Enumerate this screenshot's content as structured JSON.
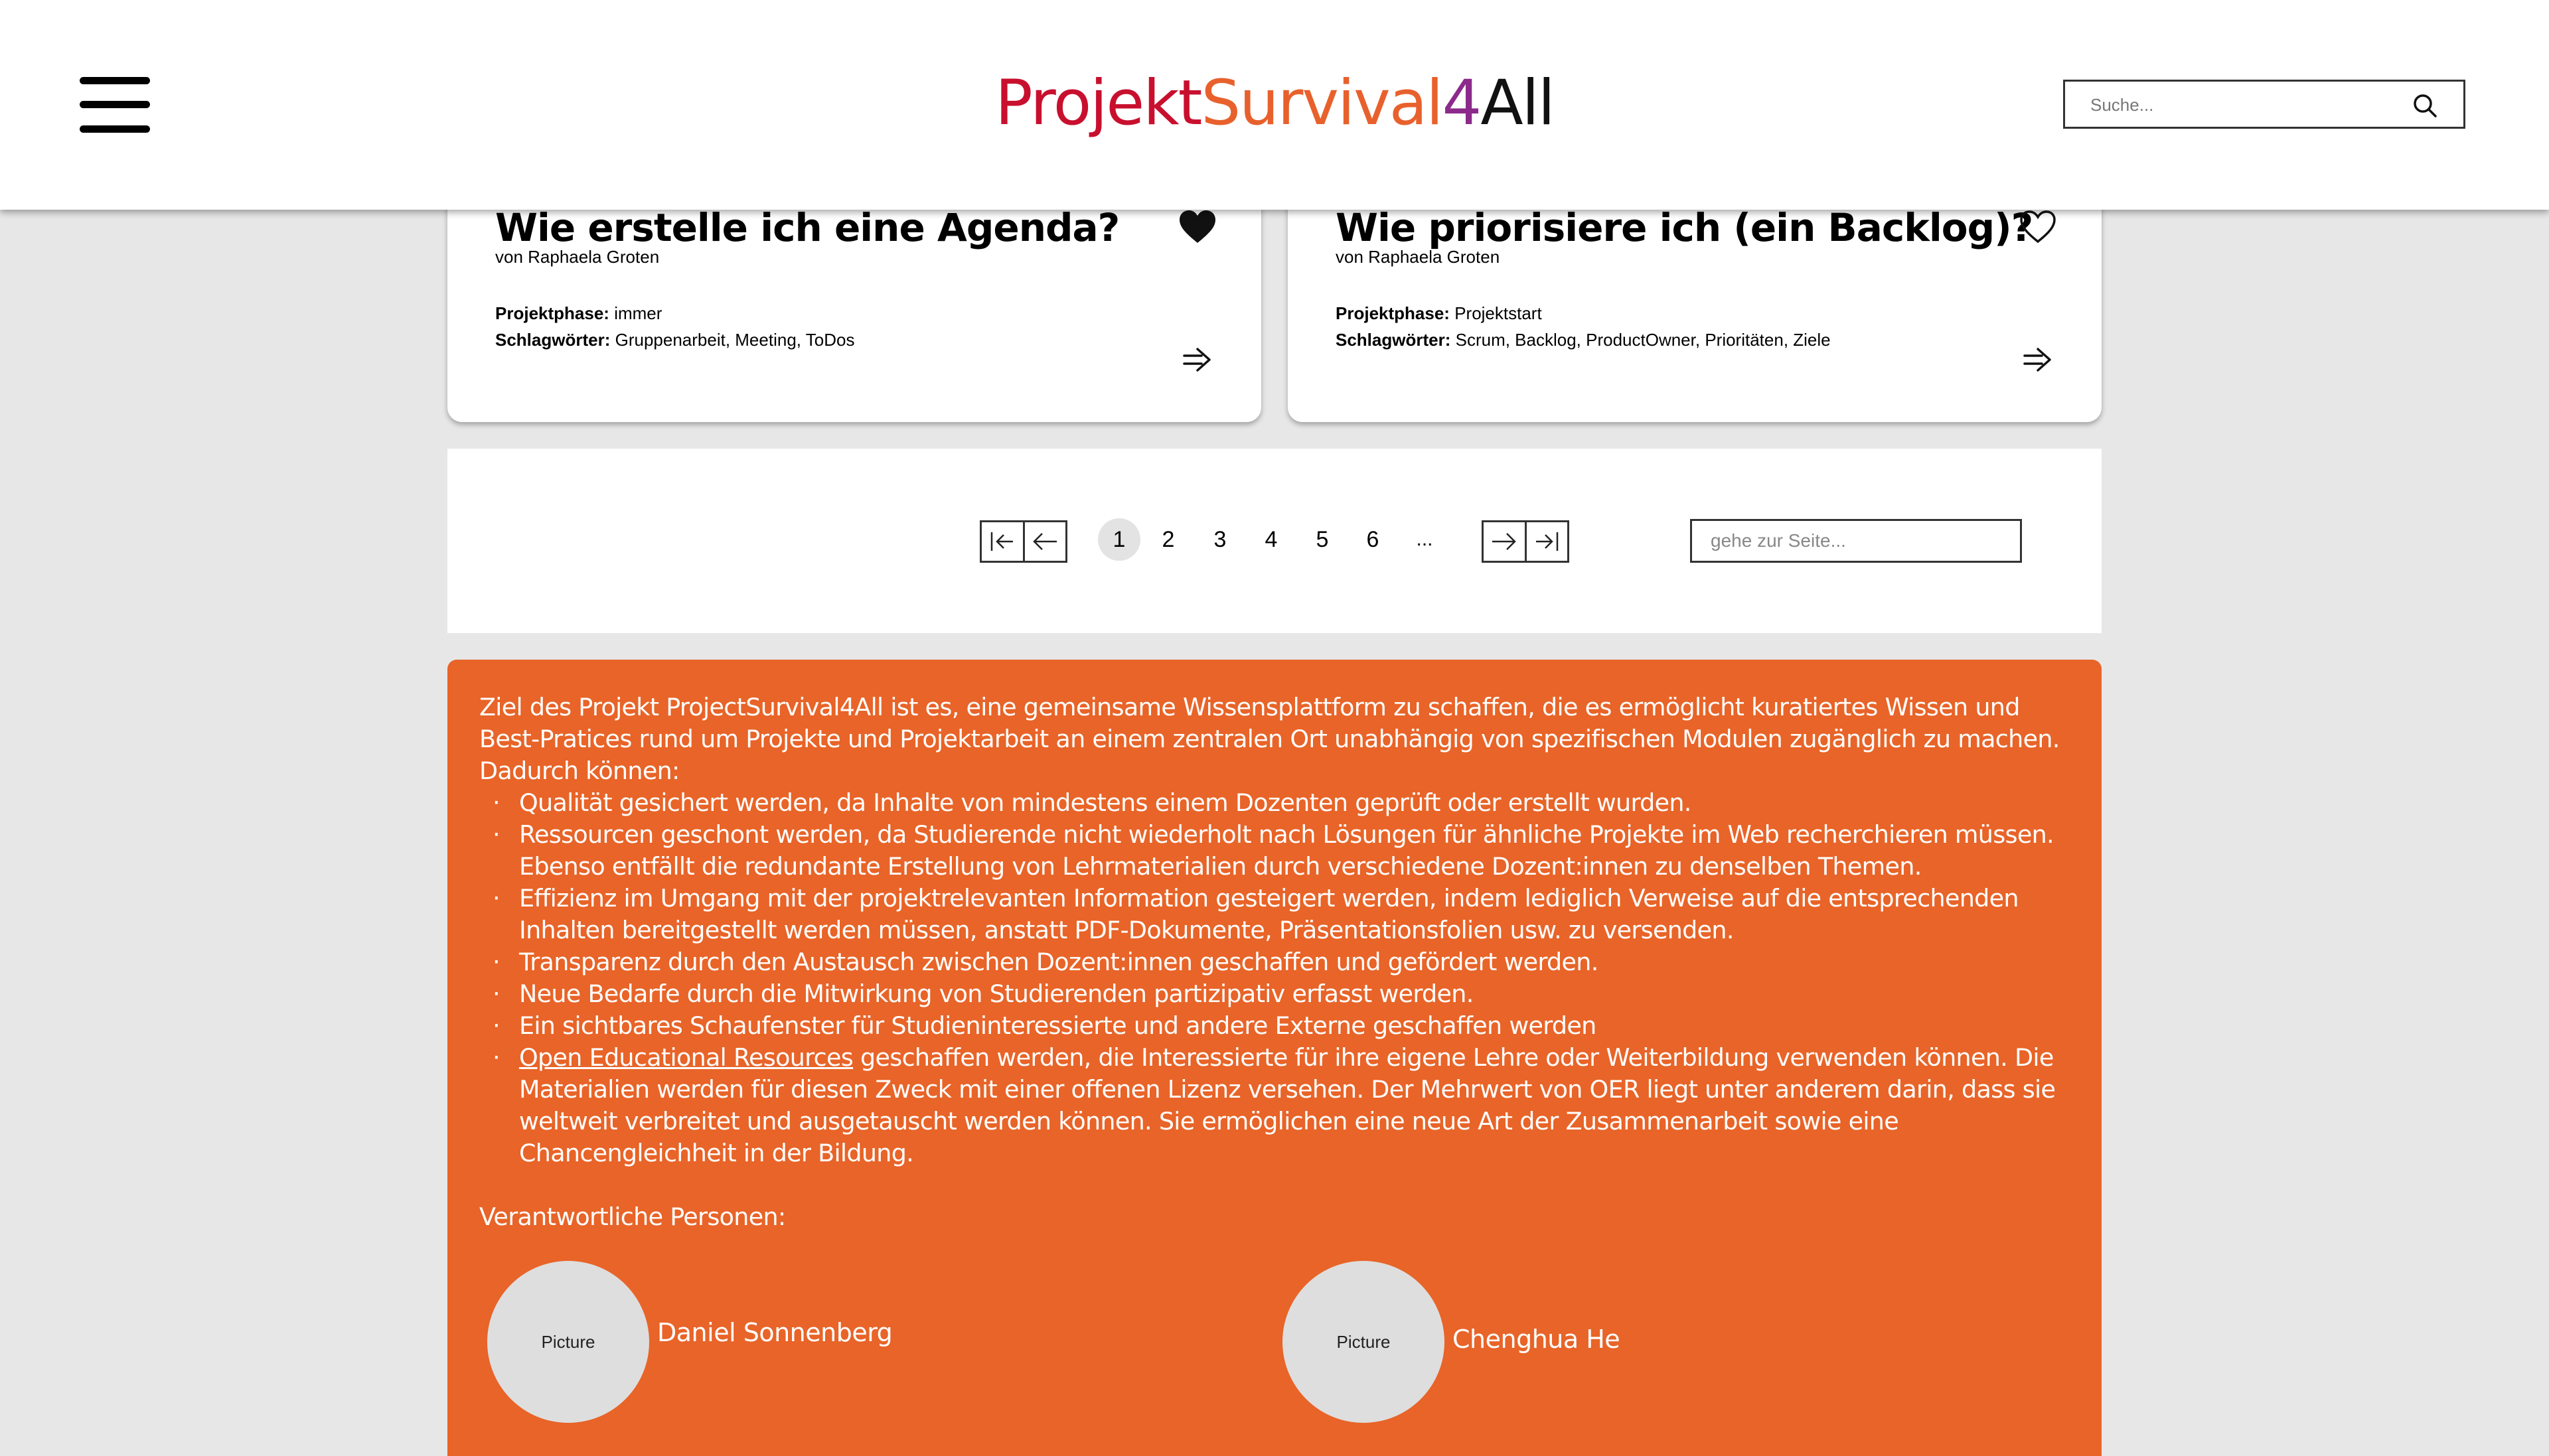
{
  "header": {
    "logo": {
      "part1": "Projekt",
      "part2": "Survival",
      "part3": "4",
      "part4": "All"
    },
    "search_placeholder": "Suche...",
    "colors": {
      "projekt": "#c8102e",
      "survival": "#e8612c",
      "four": "#8c2a8c",
      "all": "#111111"
    }
  },
  "cards": [
    {
      "title": "Wie erstelle ich eine Agenda?",
      "author": "von Raphaela Groten",
      "phase_label": "Projektphase:",
      "phase_value": "immer",
      "tags_label": "Schlagwörter:",
      "tags_value": "Gruppenarbeit, Meeting, ToDos",
      "favorite": true,
      "icon": "heart-filled-icon"
    },
    {
      "title": "Wie priorisiere ich (ein Backlog)?",
      "author": "von Raphaela Groten",
      "phase_label": "Projektphase:",
      "phase_value": "Projektstart",
      "tags_label": "Schlagwörter:",
      "tags_value": "Scrum, Backlog, ProductOwner, Prioritäten, Ziele",
      "favorite": false,
      "icon": "heart-outline-icon"
    }
  ],
  "pagination": {
    "pages": [
      "1",
      "2",
      "3",
      "4",
      "5",
      "6"
    ],
    "ellipsis": "...",
    "current": "1",
    "goto_placeholder": "gehe zur Seite..."
  },
  "about": {
    "intro": "Ziel des Projekt ProjectSurvival4All ist es, eine gemeinsame Wissensplattform zu schaffen, die es ermöglicht kuratiertes Wissen und Best-Pratices rund um Projekte und Projektarbeit an einem zentralen Ort unabhängig von spezifischen Modulen zugänglich zu machen. Dadurch können:",
    "bullets": [
      "Qualität gesichert werden, da Inhalte von mindestens einem Dozenten geprüft oder erstellt wurden.",
      "Ressourcen geschont werden, da Studierende nicht wiederholt nach Lösungen für ähnliche Projekte im Web recherchieren müssen. Ebenso entfällt die redundante Erstellung von Lehrmaterialien durch verschiedene Dozent:innen zu denselben Themen.",
      "Effizienz im Umgang mit der projektrelevanten Information gesteigert werden, indem lediglich Verweise auf die entsprechenden Inhalten bereitgestellt werden müssen, anstatt PDF-Dokumente, Präsentationsfolien usw. zu versenden.",
      "Transparenz durch den Austausch zwischen Dozent:innen geschaffen und gefördert werden.",
      "Neue Bedarfe durch die Mitwirkung von Studierenden partizipativ erfasst werden.",
      "Ein sichtbares Schaufenster für Studieninteressierte und andere Externe geschaffen werden"
    ],
    "oer_link": "Open Educational Resources",
    "oer_text": " geschaffen werden, die Interessierte für ihre eigene Lehre oder Weiterbildung verwenden können. Die Materialien werden für diesen Zweck mit einer offenen Lizenz versehen. Der Mehrwert von OER liegt unter anderem darin, dass sie weltweit verbreitet und ausgetauscht werden können. Sie ermöglichen eine neue Art der Zusammenarbeit sowie eine Chancengleichheit in der Bildung.",
    "responsible_label": "Verantwortliche Personen:",
    "people": [
      {
        "name": "Daniel Sonnenberg",
        "picture": "Picture"
      },
      {
        "name": "Chenghua He",
        "picture": "Picture"
      }
    ],
    "background_color": "#e86428"
  }
}
